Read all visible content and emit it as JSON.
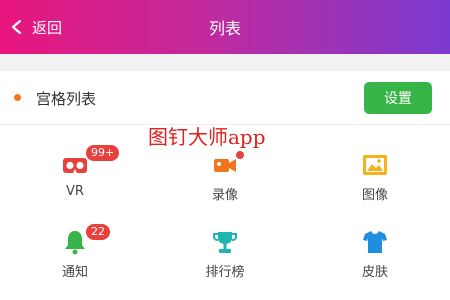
{
  "header": {
    "back_label": "返回",
    "title": "列表",
    "gradient": [
      "#e8167e",
      "#7b3bd1"
    ]
  },
  "section": {
    "title": "宫格列表",
    "button_label": "设置",
    "button_color": "#38b548",
    "dot_color": "#f2751e"
  },
  "watermark": "图钉大师app",
  "grid": [
    {
      "label": "VR",
      "icon": "vr-headset-icon",
      "color": "#e8403c",
      "badge": "99+"
    },
    {
      "label": "录像",
      "icon": "video-camera-icon",
      "color": "#f2751e",
      "badge": ""
    },
    {
      "label": "图像",
      "icon": "image-icon",
      "color": "#f5b21a",
      "badge": ""
    },
    {
      "label": "通知",
      "icon": "bell-icon",
      "color": "#38b548",
      "badge": "22"
    },
    {
      "label": "排行榜",
      "icon": "trophy-icon",
      "color": "#1fb5b0",
      "badge": ""
    },
    {
      "label": "皮肤",
      "icon": "shirt-icon",
      "color": "#1e8fe0",
      "badge": ""
    }
  ]
}
